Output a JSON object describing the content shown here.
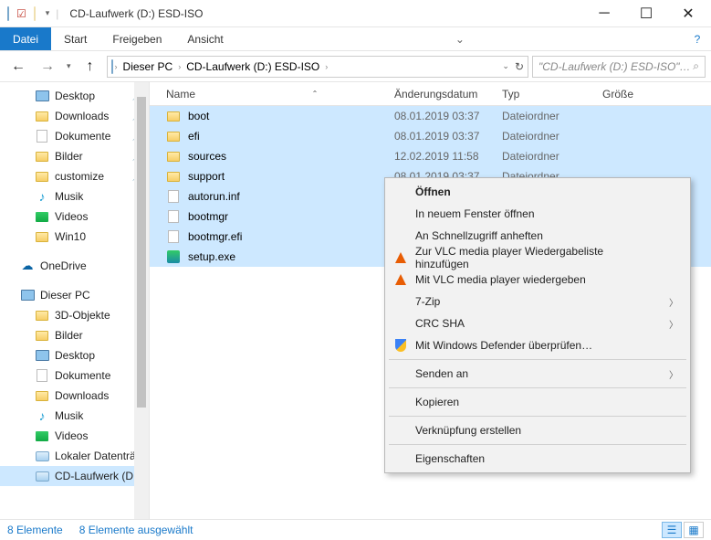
{
  "window": {
    "title": "CD-Laufwerk (D:) ESD-ISO"
  },
  "ribbon": {
    "file": "Datei",
    "tabs": [
      "Start",
      "Freigeben",
      "Ansicht"
    ]
  },
  "breadcrumb": {
    "parts": [
      "Dieser PC",
      "CD-Laufwerk (D:) ESD-ISO"
    ]
  },
  "search": {
    "placeholder": "\"CD-Laufwerk (D:) ESD-ISO\" d…"
  },
  "nav": {
    "quickaccess": [
      {
        "label": "Desktop",
        "icon": "monitor",
        "pinned": true
      },
      {
        "label": "Downloads",
        "icon": "folder",
        "pinned": true
      },
      {
        "label": "Dokumente",
        "icon": "file",
        "pinned": true
      },
      {
        "label": "Bilder",
        "icon": "folder",
        "pinned": true
      },
      {
        "label": "customize",
        "icon": "folder",
        "pinned": true
      },
      {
        "label": "Musik",
        "icon": "music",
        "pinned": false
      },
      {
        "label": "Videos",
        "icon": "video",
        "pinned": false
      },
      {
        "label": "Win10",
        "icon": "folder",
        "pinned": false
      }
    ],
    "onedrive": "OneDrive",
    "thispc": "Dieser PC",
    "thispc_children": [
      {
        "label": "3D-Objekte",
        "icon": "folder"
      },
      {
        "label": "Bilder",
        "icon": "folder"
      },
      {
        "label": "Desktop",
        "icon": "monitor"
      },
      {
        "label": "Dokumente",
        "icon": "file"
      },
      {
        "label": "Downloads",
        "icon": "folder"
      },
      {
        "label": "Musik",
        "icon": "music"
      },
      {
        "label": "Videos",
        "icon": "video"
      },
      {
        "label": "Lokaler Datenträ",
        "icon": "drive"
      },
      {
        "label": "CD-Laufwerk (D:)",
        "icon": "drive",
        "selected": true
      }
    ]
  },
  "columns": {
    "name": "Name",
    "date": "Änderungsdatum",
    "type": "Typ",
    "size": "Größe"
  },
  "files": [
    {
      "name": "boot",
      "date": "08.01.2019 03:37",
      "type": "Dateiordner",
      "icon": "folder"
    },
    {
      "name": "efi",
      "date": "08.01.2019 03:37",
      "type": "Dateiordner",
      "icon": "folder"
    },
    {
      "name": "sources",
      "date": "12.02.2019 11:58",
      "type": "Dateiordner",
      "icon": "folder"
    },
    {
      "name": "support",
      "date": "08.01.2019 03:37",
      "type": "Dateiordner",
      "icon": "folder"
    },
    {
      "name": "autorun.inf",
      "date": "",
      "type": "",
      "icon": "file"
    },
    {
      "name": "bootmgr",
      "date": "",
      "type": "",
      "icon": "file"
    },
    {
      "name": "bootmgr.efi",
      "date": "",
      "type": "",
      "icon": "file"
    },
    {
      "name": "setup.exe",
      "date": "",
      "type": "",
      "icon": "setup"
    }
  ],
  "context": {
    "items": [
      {
        "label": "Öffnen",
        "default": true
      },
      {
        "label": "In neuem Fenster öffnen"
      },
      {
        "label": "An Schnellzugriff anheften"
      },
      {
        "label": "Zur VLC media player Wiedergabeliste hinzufügen",
        "icon": "vlc"
      },
      {
        "label": "Mit VLC media player wiedergeben",
        "icon": "vlc"
      },
      {
        "label": "7-Zip",
        "sub": true
      },
      {
        "label": "CRC SHA",
        "sub": true
      },
      {
        "label": "Mit Windows Defender überprüfen…",
        "icon": "shield",
        "sepafter": true
      },
      {
        "label": "Senden an",
        "sub": true,
        "sepafter": true
      },
      {
        "label": "Kopieren",
        "sepafter": true
      },
      {
        "label": "Verknüpfung erstellen",
        "sepafter": true
      },
      {
        "label": "Eigenschaften"
      }
    ]
  },
  "status": {
    "count": "8 Elemente",
    "selected": "8 Elemente ausgewählt"
  }
}
